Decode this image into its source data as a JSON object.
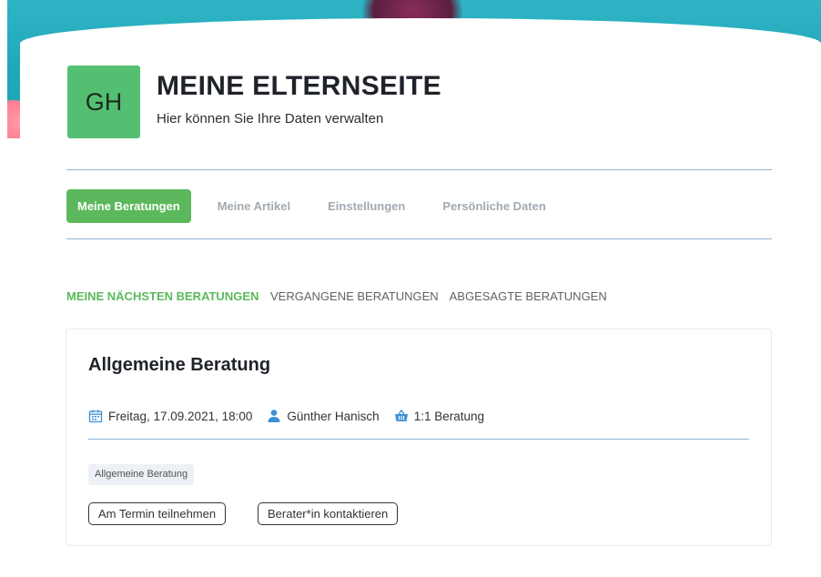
{
  "header": {
    "avatar_initials": "GH",
    "title": "MEINE ELTERNSEITE",
    "subtitle": "Hier können Sie Ihre Daten verwalten"
  },
  "tabs": [
    {
      "label": "Meine Beratungen",
      "active": true
    },
    {
      "label": "Meine Artikel",
      "active": false
    },
    {
      "label": "Einstellungen",
      "active": false
    },
    {
      "label": "Persönliche Daten",
      "active": false
    }
  ],
  "subtabs": [
    {
      "label": "MEINE NÄCHSTEN BERATUNGEN",
      "active": true
    },
    {
      "label": "VERGANGENE BERATUNGEN",
      "active": false
    },
    {
      "label": "ABGESAGTE BERATUNGEN",
      "active": false
    }
  ],
  "appointment": {
    "title": "Allgemeine Beratung",
    "date": "Freitag, 17.09.2021, 18:00",
    "advisor": "Günther Hanisch",
    "type": "1:1 Beratung",
    "tag": "Allgemeine Beratung",
    "join_button": "Am Termin teilnehmen",
    "contact_button": "Berater*in kontaktieren"
  },
  "icons": {
    "date": "calendar-icon",
    "advisor": "person-icon",
    "type": "basket-icon"
  },
  "colors": {
    "accent": "#5cb85c",
    "avatar": "#53c071",
    "icon_blue": "#3d8fd6",
    "divider": "#8fb3d8",
    "hero": "#23a6b5"
  }
}
